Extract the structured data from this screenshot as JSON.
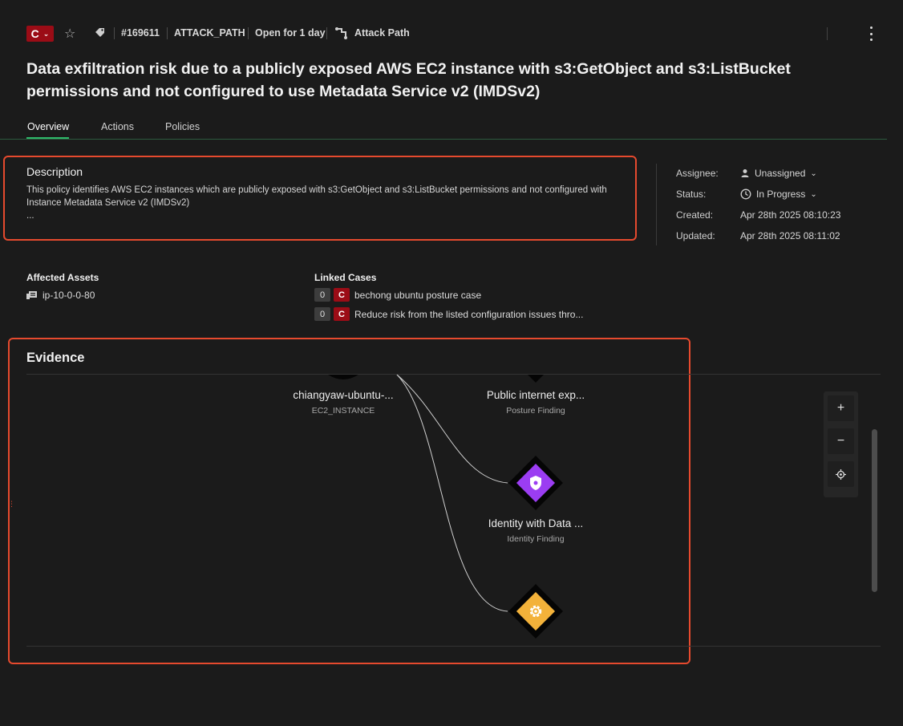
{
  "header": {
    "severity": "C",
    "issue_id": "#169611",
    "issue_type": "ATTACK_PATH",
    "open_duration": "Open for 1 day",
    "category": "Attack Path"
  },
  "title": "Data exfiltration risk due to a publicly exposed AWS EC2 instance with s3:GetObject and s3:ListBucket permissions and not configured to use Metadata Service v2 (IMDSv2)",
  "tabs": [
    {
      "label": "Overview",
      "active": true
    },
    {
      "label": "Actions",
      "active": false
    },
    {
      "label": "Policies",
      "active": false
    }
  ],
  "description": {
    "heading": "Description",
    "text": "This policy identifies AWS EC2 instances which are publicly exposed with s3:GetObject and s3:ListBucket permissions and not configured with Instance Metadata Service v2 (IMDSv2)",
    "ellipsis": "..."
  },
  "meta": {
    "assignee_label": "Assignee:",
    "assignee_value": "Unassigned",
    "status_label": "Status:",
    "status_value": "In Progress",
    "created_label": "Created:",
    "created_value": "Apr 28th 2025 08:10:23",
    "updated_label": "Updated:",
    "updated_value": "Apr 28th 2025 08:11:02"
  },
  "affected_assets": {
    "heading": "Affected Assets",
    "items": [
      "ip-10-0-0-80"
    ]
  },
  "linked_cases": {
    "heading": "Linked Cases",
    "items": [
      {
        "count": "0",
        "severity": "C",
        "name": "bechong ubuntu posture case"
      },
      {
        "count": "0",
        "severity": "C",
        "name": "Reduce risk from the listed configuration issues thro..."
      }
    ]
  },
  "evidence": {
    "heading": "Evidence",
    "nodes": [
      {
        "label": "chiangyaw-ubuntu-...",
        "type": "EC2_INSTANCE"
      },
      {
        "label": "Public internet exp...",
        "type": "Posture Finding"
      },
      {
        "label": "Identity with Data ...",
        "type": "Identity Finding",
        "icon": "shield-icon",
        "color": "#9b3df2"
      },
      {
        "label": "",
        "type": "",
        "icon": "gear-icon",
        "color": "#f3b23a"
      }
    ],
    "zoom": {
      "in": "+",
      "out": "−"
    }
  },
  "colors": {
    "accent_green": "#2fb86a",
    "critical_red": "#9b0c16",
    "highlight_orange": "#e64a2e"
  }
}
